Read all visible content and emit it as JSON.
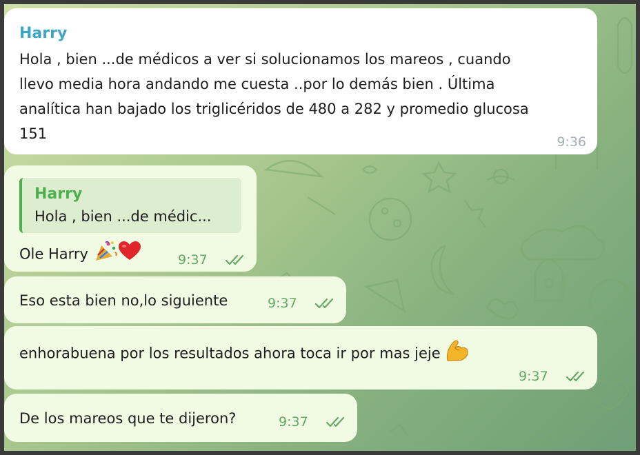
{
  "messages": [
    {
      "sender": "Harry",
      "lines": [
        "Hola , bien ...de médicos a ver si solucionamos los mareos , cuando",
        "llevo media hora andando me cuesta ..por lo demás bien .  Última",
        "analítica han bajado los triglicéridos de 480 a 282 y promedio glucosa",
        "151"
      ],
      "time": "9:36"
    },
    {
      "reply_to": {
        "sender": "Harry",
        "snippet": "Hola , bien ...de médic..."
      },
      "text": "Ole Harry",
      "emojis": [
        "party-popper",
        "red-heart"
      ],
      "time": "9:37",
      "status": "read"
    },
    {
      "text": "Eso esta bien no,lo siguiente",
      "time": "9:37",
      "status": "read"
    },
    {
      "text": "enhorabuena por los resultados ahora toca ir por mas jeje",
      "emojis": [
        "flexed-biceps"
      ],
      "time": "9:37",
      "status": "read"
    },
    {
      "text": "De los mareos que te dijeron?",
      "time": "9:37",
      "status": "read"
    }
  ],
  "colors": {
    "sender_name": "#3fa5c6",
    "reply_accent": "#4fae4e",
    "outgoing_bubble": "#f1fbe3",
    "incoming_bubble": "#ffffff",
    "outgoing_time": "#63a866",
    "incoming_time": "#a4adb3"
  }
}
